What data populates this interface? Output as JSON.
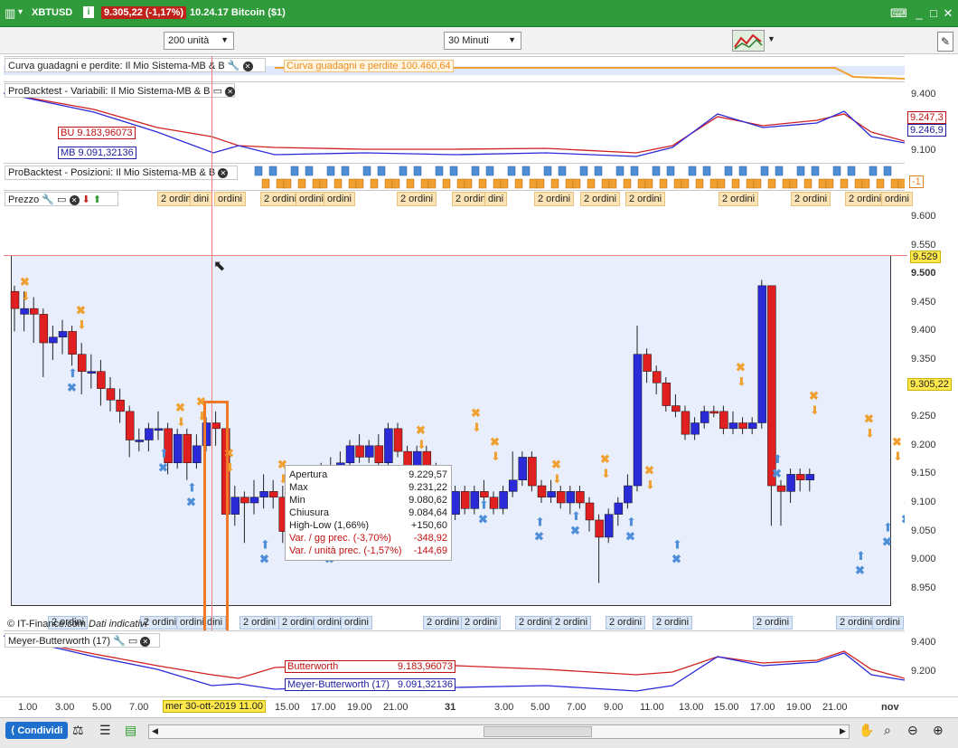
{
  "titlebar": {
    "symbol": "XBTUSD",
    "price_change": "9.305,22 (-1,17%)",
    "time_label": "10.24.17 Bitcoin ($1)"
  },
  "toolbar": {
    "units_select": "200 unità",
    "interval_select": "30 Minuti"
  },
  "equity_panel": {
    "title": "Curva guadagni e perdite: Il Mio Sistema-MB & B",
    "badge": "Curva guadagni e perdite   100.460,64"
  },
  "vars_panel": {
    "title": "ProBacktest - Variabili: Il Mio Sistema-MB & B",
    "bu_label": "BU   9.183,96073",
    "mb_label": "MB   9.091,32136",
    "axis": [
      "9.400",
      "9.100"
    ],
    "right_badges": [
      "9.247,3",
      "9.246,9"
    ]
  },
  "pos_panel": {
    "title": "ProBacktest - Posizioni: Il Mio Sistema-MB & B",
    "right_badge": "-1"
  },
  "price_panel": {
    "title": "Prezzo",
    "orders_top": [
      "2 ordini",
      "dini",
      "ordini",
      "2 ordini",
      "ordini",
      "ordini",
      "2 ordini",
      "2 ordini",
      "dini",
      "2 ordini",
      "2 ordini",
      "2 ordini",
      "2 ordini",
      "2 ordini",
      "2 ordini",
      "ordini"
    ],
    "orders_bottom": [
      "2 ordini",
      "2 ordini",
      "ordini",
      "dini",
      "2 ordini",
      "2 ordini",
      "ordini",
      "ordini",
      "2 ordini",
      "2 ordini",
      "2 ordini",
      "2 ordini",
      "2 ordini",
      "2 ordini",
      "2 ordini",
      "2 ordini",
      "ordini"
    ],
    "axis": [
      "9.600",
      "9.550",
      "9.500",
      "9.450",
      "9.400",
      "9.350",
      "9.300",
      "9.250",
      "9.200",
      "9.150",
      "9.100",
      "9.050",
      "9.000",
      "8.950"
    ],
    "badge_high": "9.529",
    "badge_last": "9.305,22",
    "copyright": "© IT-Finance.com",
    "data_note": "Dati indicativi"
  },
  "tooltip": {
    "rows": [
      {
        "k": "Apertura",
        "v": "9.229,57"
      },
      {
        "k": "Max",
        "v": "9.231,22"
      },
      {
        "k": "Min",
        "v": "9.080,62"
      },
      {
        "k": "Chiusura",
        "v": "9.084,64"
      },
      {
        "k": "High-Low (1,66%)",
        "v": "+150,60"
      },
      {
        "k": "Var. / gg prec. (-3,70%)",
        "v": "-348,92"
      },
      {
        "k": "Var. / unità prec. (-1,57%)",
        "v": "-144,69"
      }
    ]
  },
  "meyer_panel": {
    "title": "Meyer-Butterworth (17)",
    "butter_label": "Butterworth",
    "butter_value": "9.183,96073",
    "meyer_label": "Meyer-Butterworth (17)",
    "meyer_value": "9.091,32136",
    "axis": [
      "9.400",
      "9.200"
    ]
  },
  "time_axis": {
    "ticks": [
      "1.00",
      "3.00",
      "5.00",
      "7.00",
      "15.00",
      "17.00",
      "19.00",
      "21.00",
      "31",
      "3.00",
      "5.00",
      "7.00",
      "9.00",
      "11.00",
      "13.00",
      "15.00",
      "17.00",
      "19.00",
      "21.00",
      "nov"
    ],
    "highlight": "mer 30-ott-2019 11.00"
  },
  "bottombar": {
    "share_label": "Condividi"
  },
  "colors": {
    "accent_green": "#2f9b3a",
    "bull": "#2a2ad9",
    "bear": "#e02020",
    "buy_arrow": "#4f8fd8",
    "sell_arrow": "#f0a030",
    "highlight_box": "#f07a28",
    "chart_bg": "#e9eefc"
  },
  "chart_data": {
    "type": "candlestick",
    "series": [
      {
        "name": "BU",
        "values": [
          9.3836,
          9.3436,
          9.1839
        ]
      },
      {
        "name": "MB",
        "values": [
          9.3836,
          9.3436,
          9.0913
        ]
      }
    ]
  }
}
